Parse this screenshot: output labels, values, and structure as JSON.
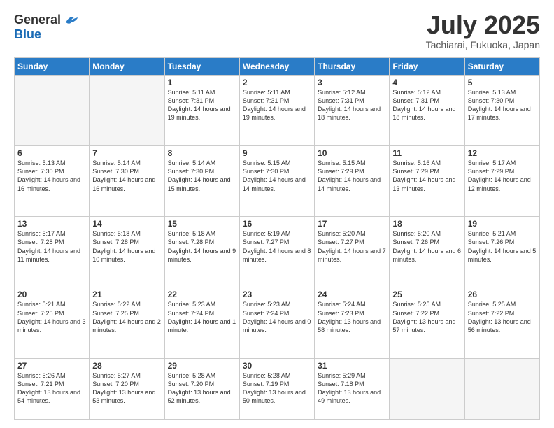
{
  "header": {
    "logo_general": "General",
    "logo_blue": "Blue",
    "month": "July 2025",
    "location": "Tachiarai, Fukuoka, Japan"
  },
  "weekdays": [
    "Sunday",
    "Monday",
    "Tuesday",
    "Wednesday",
    "Thursday",
    "Friday",
    "Saturday"
  ],
  "weeks": [
    [
      {
        "day": "",
        "sunrise": "",
        "sunset": "",
        "daylight": ""
      },
      {
        "day": "",
        "sunrise": "",
        "sunset": "",
        "daylight": ""
      },
      {
        "day": "1",
        "sunrise": "Sunrise: 5:11 AM",
        "sunset": "Sunset: 7:31 PM",
        "daylight": "Daylight: 14 hours and 19 minutes."
      },
      {
        "day": "2",
        "sunrise": "Sunrise: 5:11 AM",
        "sunset": "Sunset: 7:31 PM",
        "daylight": "Daylight: 14 hours and 19 minutes."
      },
      {
        "day": "3",
        "sunrise": "Sunrise: 5:12 AM",
        "sunset": "Sunset: 7:31 PM",
        "daylight": "Daylight: 14 hours and 18 minutes."
      },
      {
        "day": "4",
        "sunrise": "Sunrise: 5:12 AM",
        "sunset": "Sunset: 7:31 PM",
        "daylight": "Daylight: 14 hours and 18 minutes."
      },
      {
        "day": "5",
        "sunrise": "Sunrise: 5:13 AM",
        "sunset": "Sunset: 7:30 PM",
        "daylight": "Daylight: 14 hours and 17 minutes."
      }
    ],
    [
      {
        "day": "6",
        "sunrise": "Sunrise: 5:13 AM",
        "sunset": "Sunset: 7:30 PM",
        "daylight": "Daylight: 14 hours and 16 minutes."
      },
      {
        "day": "7",
        "sunrise": "Sunrise: 5:14 AM",
        "sunset": "Sunset: 7:30 PM",
        "daylight": "Daylight: 14 hours and 16 minutes."
      },
      {
        "day": "8",
        "sunrise": "Sunrise: 5:14 AM",
        "sunset": "Sunset: 7:30 PM",
        "daylight": "Daylight: 14 hours and 15 minutes."
      },
      {
        "day": "9",
        "sunrise": "Sunrise: 5:15 AM",
        "sunset": "Sunset: 7:30 PM",
        "daylight": "Daylight: 14 hours and 14 minutes."
      },
      {
        "day": "10",
        "sunrise": "Sunrise: 5:15 AM",
        "sunset": "Sunset: 7:29 PM",
        "daylight": "Daylight: 14 hours and 14 minutes."
      },
      {
        "day": "11",
        "sunrise": "Sunrise: 5:16 AM",
        "sunset": "Sunset: 7:29 PM",
        "daylight": "Daylight: 14 hours and 13 minutes."
      },
      {
        "day": "12",
        "sunrise": "Sunrise: 5:17 AM",
        "sunset": "Sunset: 7:29 PM",
        "daylight": "Daylight: 14 hours and 12 minutes."
      }
    ],
    [
      {
        "day": "13",
        "sunrise": "Sunrise: 5:17 AM",
        "sunset": "Sunset: 7:28 PM",
        "daylight": "Daylight: 14 hours and 11 minutes."
      },
      {
        "day": "14",
        "sunrise": "Sunrise: 5:18 AM",
        "sunset": "Sunset: 7:28 PM",
        "daylight": "Daylight: 14 hours and 10 minutes."
      },
      {
        "day": "15",
        "sunrise": "Sunrise: 5:18 AM",
        "sunset": "Sunset: 7:28 PM",
        "daylight": "Daylight: 14 hours and 9 minutes."
      },
      {
        "day": "16",
        "sunrise": "Sunrise: 5:19 AM",
        "sunset": "Sunset: 7:27 PM",
        "daylight": "Daylight: 14 hours and 8 minutes."
      },
      {
        "day": "17",
        "sunrise": "Sunrise: 5:20 AM",
        "sunset": "Sunset: 7:27 PM",
        "daylight": "Daylight: 14 hours and 7 minutes."
      },
      {
        "day": "18",
        "sunrise": "Sunrise: 5:20 AM",
        "sunset": "Sunset: 7:26 PM",
        "daylight": "Daylight: 14 hours and 6 minutes."
      },
      {
        "day": "19",
        "sunrise": "Sunrise: 5:21 AM",
        "sunset": "Sunset: 7:26 PM",
        "daylight": "Daylight: 14 hours and 5 minutes."
      }
    ],
    [
      {
        "day": "20",
        "sunrise": "Sunrise: 5:21 AM",
        "sunset": "Sunset: 7:25 PM",
        "daylight": "Daylight: 14 hours and 3 minutes."
      },
      {
        "day": "21",
        "sunrise": "Sunrise: 5:22 AM",
        "sunset": "Sunset: 7:25 PM",
        "daylight": "Daylight: 14 hours and 2 minutes."
      },
      {
        "day": "22",
        "sunrise": "Sunrise: 5:23 AM",
        "sunset": "Sunset: 7:24 PM",
        "daylight": "Daylight: 14 hours and 1 minute."
      },
      {
        "day": "23",
        "sunrise": "Sunrise: 5:23 AM",
        "sunset": "Sunset: 7:24 PM",
        "daylight": "Daylight: 14 hours and 0 minutes."
      },
      {
        "day": "24",
        "sunrise": "Sunrise: 5:24 AM",
        "sunset": "Sunset: 7:23 PM",
        "daylight": "Daylight: 13 hours and 58 minutes."
      },
      {
        "day": "25",
        "sunrise": "Sunrise: 5:25 AM",
        "sunset": "Sunset: 7:22 PM",
        "daylight": "Daylight: 13 hours and 57 minutes."
      },
      {
        "day": "26",
        "sunrise": "Sunrise: 5:25 AM",
        "sunset": "Sunset: 7:22 PM",
        "daylight": "Daylight: 13 hours and 56 minutes."
      }
    ],
    [
      {
        "day": "27",
        "sunrise": "Sunrise: 5:26 AM",
        "sunset": "Sunset: 7:21 PM",
        "daylight": "Daylight: 13 hours and 54 minutes."
      },
      {
        "day": "28",
        "sunrise": "Sunrise: 5:27 AM",
        "sunset": "Sunset: 7:20 PM",
        "daylight": "Daylight: 13 hours and 53 minutes."
      },
      {
        "day": "29",
        "sunrise": "Sunrise: 5:28 AM",
        "sunset": "Sunset: 7:20 PM",
        "daylight": "Daylight: 13 hours and 52 minutes."
      },
      {
        "day": "30",
        "sunrise": "Sunrise: 5:28 AM",
        "sunset": "Sunset: 7:19 PM",
        "daylight": "Daylight: 13 hours and 50 minutes."
      },
      {
        "day": "31",
        "sunrise": "Sunrise: 5:29 AM",
        "sunset": "Sunset: 7:18 PM",
        "daylight": "Daylight: 13 hours and 49 minutes."
      },
      {
        "day": "",
        "sunrise": "",
        "sunset": "",
        "daylight": ""
      },
      {
        "day": "",
        "sunrise": "",
        "sunset": "",
        "daylight": ""
      }
    ]
  ]
}
